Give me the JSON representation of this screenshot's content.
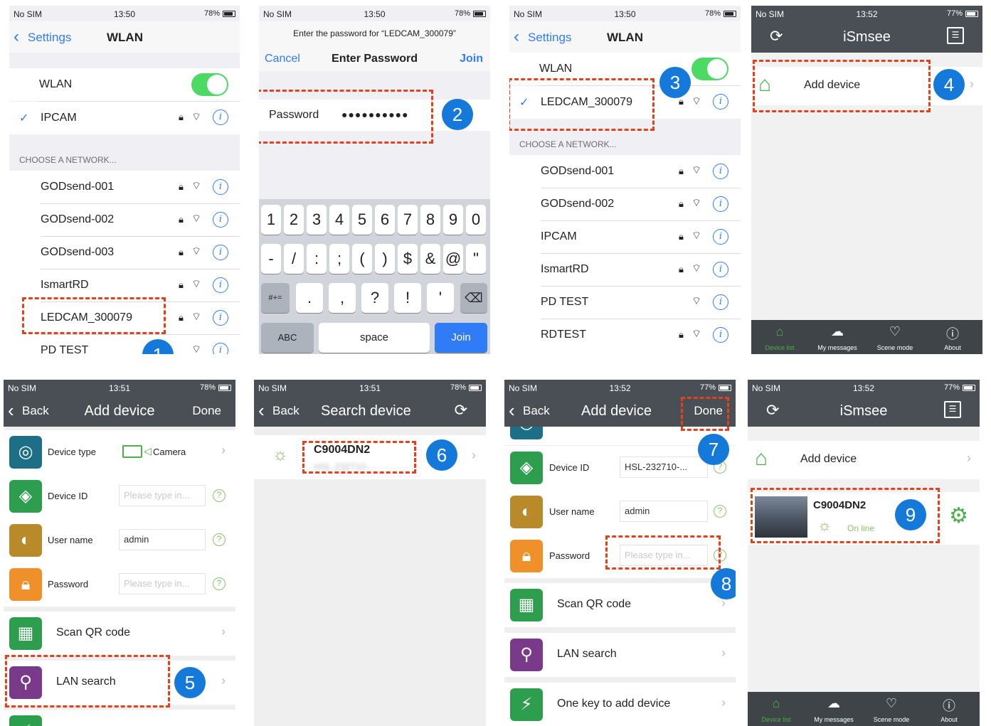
{
  "p1": {
    "status": {
      "carrier": "No SIM",
      "time": "13:50",
      "battery": "78%"
    },
    "back": "Settings",
    "title": "WLAN",
    "wlan": "WLAN",
    "connected": "IPCAM",
    "section": "CHOOSE A NETWORK...",
    "networks": [
      "GODsend-001",
      "GODsend-002",
      "GODsend-003",
      "IsmartRD",
      "LEDCAM_300079",
      "PD TEST"
    ],
    "badge": "1"
  },
  "p2": {
    "status": {
      "carrier": "No SIM",
      "time": "13:50",
      "battery": "78%"
    },
    "prompt": "Enter the password for “LEDCAM_300079”",
    "cancel": "Cancel",
    "title": "Enter Password",
    "join": "Join",
    "pw_label": "Password",
    "pw_value": "●●●●●●●●●●",
    "badge": "2",
    "keys_row1": [
      "1",
      "2",
      "3",
      "4",
      "5",
      "6",
      "7",
      "8",
      "9",
      "0"
    ],
    "keys_row2": [
      "-",
      "/",
      ":",
      ";",
      "(",
      ")",
      "$",
      "&",
      "@",
      "\""
    ],
    "keys_row3": [
      ".",
      ",",
      "?",
      "!",
      "'"
    ],
    "k_mode": "#+=",
    "k_abc": "ABC",
    "k_space": "space",
    "k_join": "Join"
  },
  "p3": {
    "status": {
      "carrier": "No SIM",
      "time": "13:50",
      "battery": "78%"
    },
    "back": "Settings",
    "title": "WLAN",
    "wlan": "WLAN",
    "connected": "LEDCAM_300079",
    "section": "CHOOSE A NETWORK...",
    "networks": [
      "GODsend-001",
      "GODsend-002",
      "IPCAM",
      "IsmartRD",
      "PD TEST",
      "RDTEST"
    ],
    "badge": "3"
  },
  "p4": {
    "status": {
      "carrier": "No SIM",
      "time": "13:52",
      "battery": "77%"
    },
    "title": "iSmsee",
    "add": "Add device",
    "badge": "4",
    "tabs": [
      "Device list",
      "My messages",
      "Scene mode",
      "About"
    ]
  },
  "p5": {
    "status": {
      "carrier": "No SIM",
      "time": "13:51",
      "battery": "78%"
    },
    "back": "Back",
    "title": "Add device",
    "done": "Done",
    "device_type": "Device type",
    "camera": "Camera",
    "device_id": "Device ID",
    "id_ph": "Please type in...",
    "user": "User name",
    "user_val": "admin",
    "password": "Password",
    "pw_ph": "Please type in...",
    "scan": "Scan QR code",
    "lan": "LAN search",
    "badge": "5"
  },
  "p6": {
    "status": {
      "carrier": "No SIM",
      "time": "13:51",
      "battery": "78%"
    },
    "back": "Back",
    "title": "Search device",
    "device": "C9004DN2",
    "sub": "HSL-232710-...",
    "badge": "6"
  },
  "p7": {
    "status": {
      "carrier": "No SIM",
      "time": "13:52",
      "battery": "77%"
    },
    "back": "Back",
    "title": "Add device",
    "done": "Done",
    "device_id": "Device ID",
    "id_val": "HSL-232710-...",
    "user": "User name",
    "user_val": "admin",
    "password": "Password",
    "pw_ph": "Please type in...",
    "scan": "Scan QR code",
    "lan": "LAN search",
    "onekey": "One key to add device",
    "badge7": "7",
    "badge8": "8"
  },
  "p8": {
    "status": {
      "carrier": "No SIM",
      "time": "13:52",
      "battery": "77%"
    },
    "title": "iSmsee",
    "add": "Add device",
    "device": "C9004DN2",
    "online": "On line",
    "badge": "9",
    "tabs": [
      "Device list",
      "My messages",
      "Scene mode",
      "About"
    ]
  }
}
